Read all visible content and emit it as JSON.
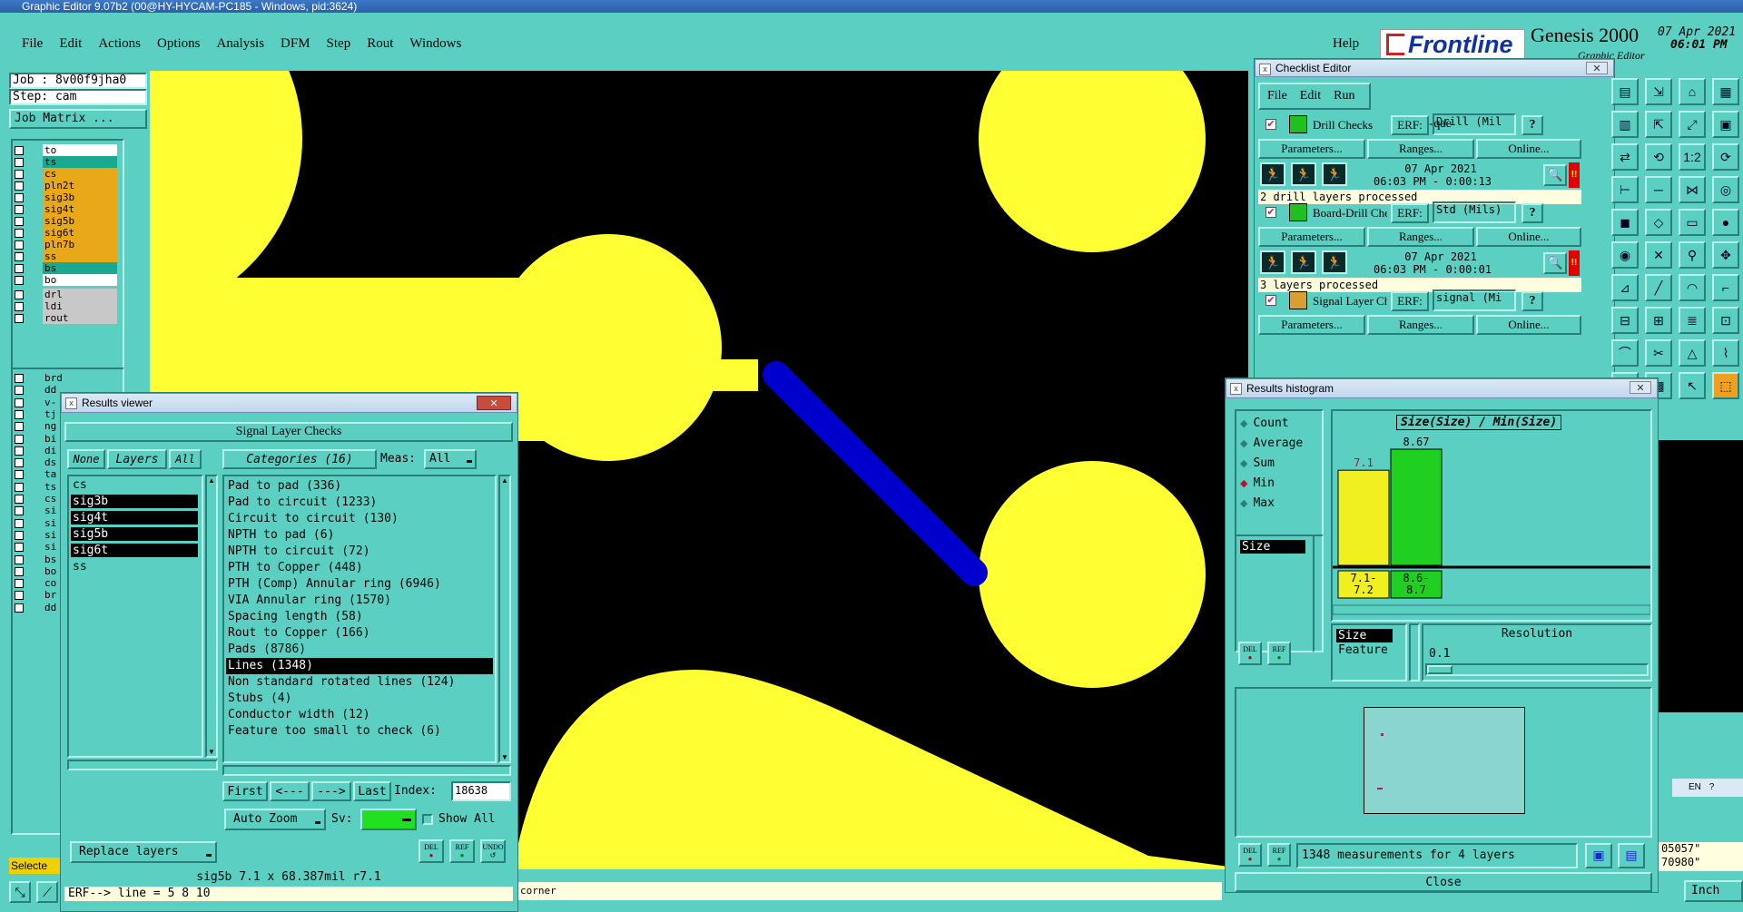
{
  "app": {
    "title": "Graphic Editor 9.07b2 (00@HY-HYCAM-PC185 - Windows, pid:3624)",
    "menu": [
      "File",
      "Edit",
      "Actions",
      "Options",
      "Analysis",
      "DFM",
      "Step",
      "Rout",
      "Windows"
    ],
    "help": "Help",
    "brand": "Frontline",
    "product": "Genesis 2000",
    "product_sub": "Graphic Editor",
    "date": "07 Apr 2021",
    "time": "06:01 PM"
  },
  "left_panel": {
    "job": "Job : 8v00f9jha0",
    "step": "Step: cam",
    "job_matrix": "Job Matrix ...",
    "layers_a": [
      {
        "name": "to",
        "color": "#ffffff"
      },
      {
        "name": "ts",
        "color": "#1aa890"
      },
      {
        "name": "cs",
        "color": "#e8a818"
      },
      {
        "name": "pln2t",
        "color": "#e8a818"
      },
      {
        "name": "sig3b",
        "color": "#e8a818"
      },
      {
        "name": "sig4t",
        "color": "#e8a818"
      },
      {
        "name": "sig5b",
        "color": "#e8a818"
      },
      {
        "name": "sig6t",
        "color": "#e8a818"
      },
      {
        "name": "pln7b",
        "color": "#e8a818"
      },
      {
        "name": "ss",
        "color": "#e8a818"
      },
      {
        "name": "bs",
        "color": "#1aa890"
      },
      {
        "name": "bo",
        "color": "#ffffff"
      }
    ],
    "layers_b": [
      {
        "name": "drl",
        "color": "#c8c8c8"
      },
      {
        "name": "ldi",
        "color": "#c8c8c8"
      },
      {
        "name": "rout",
        "color": "#c8c8c8"
      }
    ],
    "layers_c": [
      "brd",
      "dd",
      "v-",
      "tj",
      "ng",
      "bi",
      "di",
      "ds",
      "ta",
      "ts",
      "cs",
      "si",
      "si",
      "si",
      "si",
      "bs",
      "bo",
      "co",
      "br",
      "dd"
    ],
    "select_label": "Selecte"
  },
  "results_viewer": {
    "title": "Results viewer",
    "header": "Signal Layer Checks",
    "none": "None",
    "layers": "Layers",
    "all": "All",
    "categories": "Categories (16)",
    "meas_label": "Meas:",
    "meas_value": "All",
    "layer_list": [
      "cs",
      "sig3b",
      "sig4t",
      "sig5b",
      "sig6t",
      "ss"
    ],
    "categories_list": [
      "Pad to pad (336)",
      "Pad to circuit (1233)",
      "Circuit to circuit (130)",
      "NPTH to pad (6)",
      "NPTH to circuit (72)",
      "PTH to Copper (448)",
      "PTH (Comp) Annular ring (6946)",
      "VIA Annular ring (1570)",
      "Spacing length (58)",
      "Rout to Copper (166)",
      "Pads (8786)",
      "Lines (1348)",
      "Non standard rotated lines (124)",
      "Stubs (4)",
      "Conductor width (12)",
      "Feature too small to check (6)"
    ],
    "first": "First",
    "prev": "<---",
    "next": "--->",
    "last": "Last",
    "index_label": "Index:",
    "index_value": "18638",
    "auto_zoom": "Auto Zoom",
    "sv_label": "Sv:",
    "show_all": "Show All",
    "replace_layers": "Replace layers",
    "del": "DEL",
    "ref": "REF",
    "undo": "UNDO",
    "status": "sig5b  7.1 x 68.387mil  r7.1",
    "erf": "ERF--> line = 5 8 10"
  },
  "status_bar": {
    "corner": "corner"
  },
  "checklist": {
    "title": "Checklist Editor",
    "menu": [
      "File",
      "Edit",
      "Run"
    ],
    "name": "fp-qae",
    "params": "Parameters...",
    "ranges": "Ranges...",
    "online": "Online...",
    "erf": "ERF:",
    "checks": [
      {
        "name": "Drill Checks",
        "erf": "Drill (Mil",
        "date": "07 Apr 2021",
        "time": "06:03 PM - 0:00:13",
        "msg": "2 drill layers processed"
      },
      {
        "name": "Board-Drill Che",
        "erf": "Std (Mils)",
        "date": "07 Apr 2021",
        "time": "06:03 PM - 0:00:01",
        "msg": "3 layers processed"
      },
      {
        "name": "Signal Layer Ch",
        "erf": "signal (Mi"
      }
    ]
  },
  "histogram": {
    "title": "Results histogram",
    "modes": [
      "Count",
      "Average",
      "Sum",
      "Min",
      "Max"
    ],
    "selected_mode": "Min",
    "left_list": [
      "Size"
    ],
    "chart_title": "Size(Size) / Min(Size)",
    "bars": [
      {
        "label": "7.1",
        "range": "7.1- 7.2",
        "value": 7.1,
        "color": "#f0f020"
      },
      {
        "label": "8.67",
        "range": "8.6- 8.7",
        "value": 8.67,
        "color": "#20d020"
      }
    ],
    "attrs": [
      "Size",
      "Feature"
    ],
    "resolution_label": "Resolution",
    "resolution_value": "0.1",
    "summary": "1348 measurements for 4 layers",
    "close": "Close",
    "del": "DEL",
    "ref": "REF"
  },
  "right_edge": {
    "coord1": "05057\"",
    "coord2": "70980\"",
    "units": "Inch",
    "lang": "EN"
  }
}
